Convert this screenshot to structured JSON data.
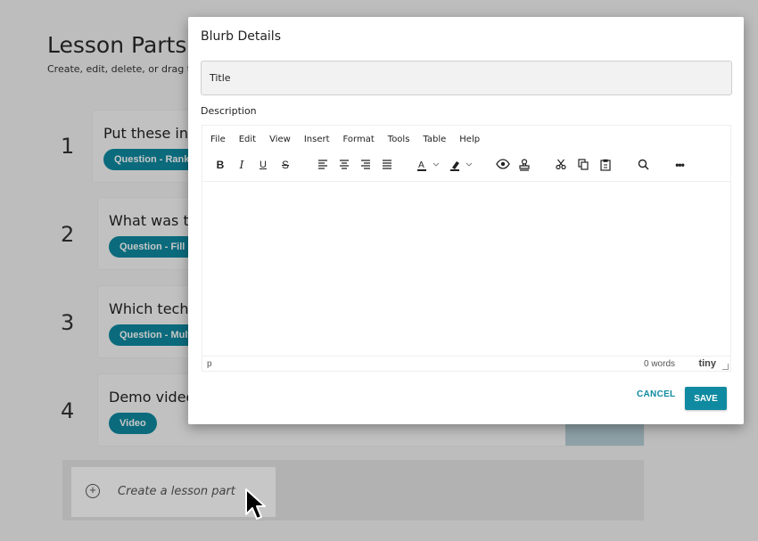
{
  "page": {
    "title": "Lesson Parts",
    "subtitle": "Create, edit, delete, or drag to"
  },
  "lessons": [
    {
      "number": "1",
      "title": "Put these in",
      "tag": "Question - Rankin"
    },
    {
      "number": "2",
      "title": "What was th",
      "tag": "Question - Fill in"
    },
    {
      "number": "3",
      "title": "Which techn",
      "tag": "Question - Multip"
    },
    {
      "number": "4",
      "title": "Demo video",
      "tag": "Video"
    }
  ],
  "create": {
    "label": "Create a lesson part",
    "icon": "plus-circle-icon"
  },
  "modal": {
    "title": "Blurb Details",
    "title_placeholder": "Title",
    "description_label": "Description",
    "menu": [
      "File",
      "Edit",
      "View",
      "Insert",
      "Format",
      "Tools",
      "Table",
      "Help"
    ],
    "toolbar_icons": [
      "bold-icon",
      "italic-icon",
      "underline-icon",
      "strikethrough-icon",
      "align-left-icon",
      "align-center-icon",
      "align-right-icon",
      "justify-icon",
      "text-color-icon",
      "highlight-color-icon",
      "preview-icon",
      "stamp-icon",
      "cut-icon",
      "copy-icon",
      "paste-icon",
      "search-icon",
      "more-icon"
    ],
    "status": {
      "path": "p",
      "words": "0 words",
      "brand": "tiny"
    },
    "cancel_label": "CANCEL",
    "save_label": "SAVE"
  },
  "colors": {
    "accent": "#0f8aa0"
  }
}
